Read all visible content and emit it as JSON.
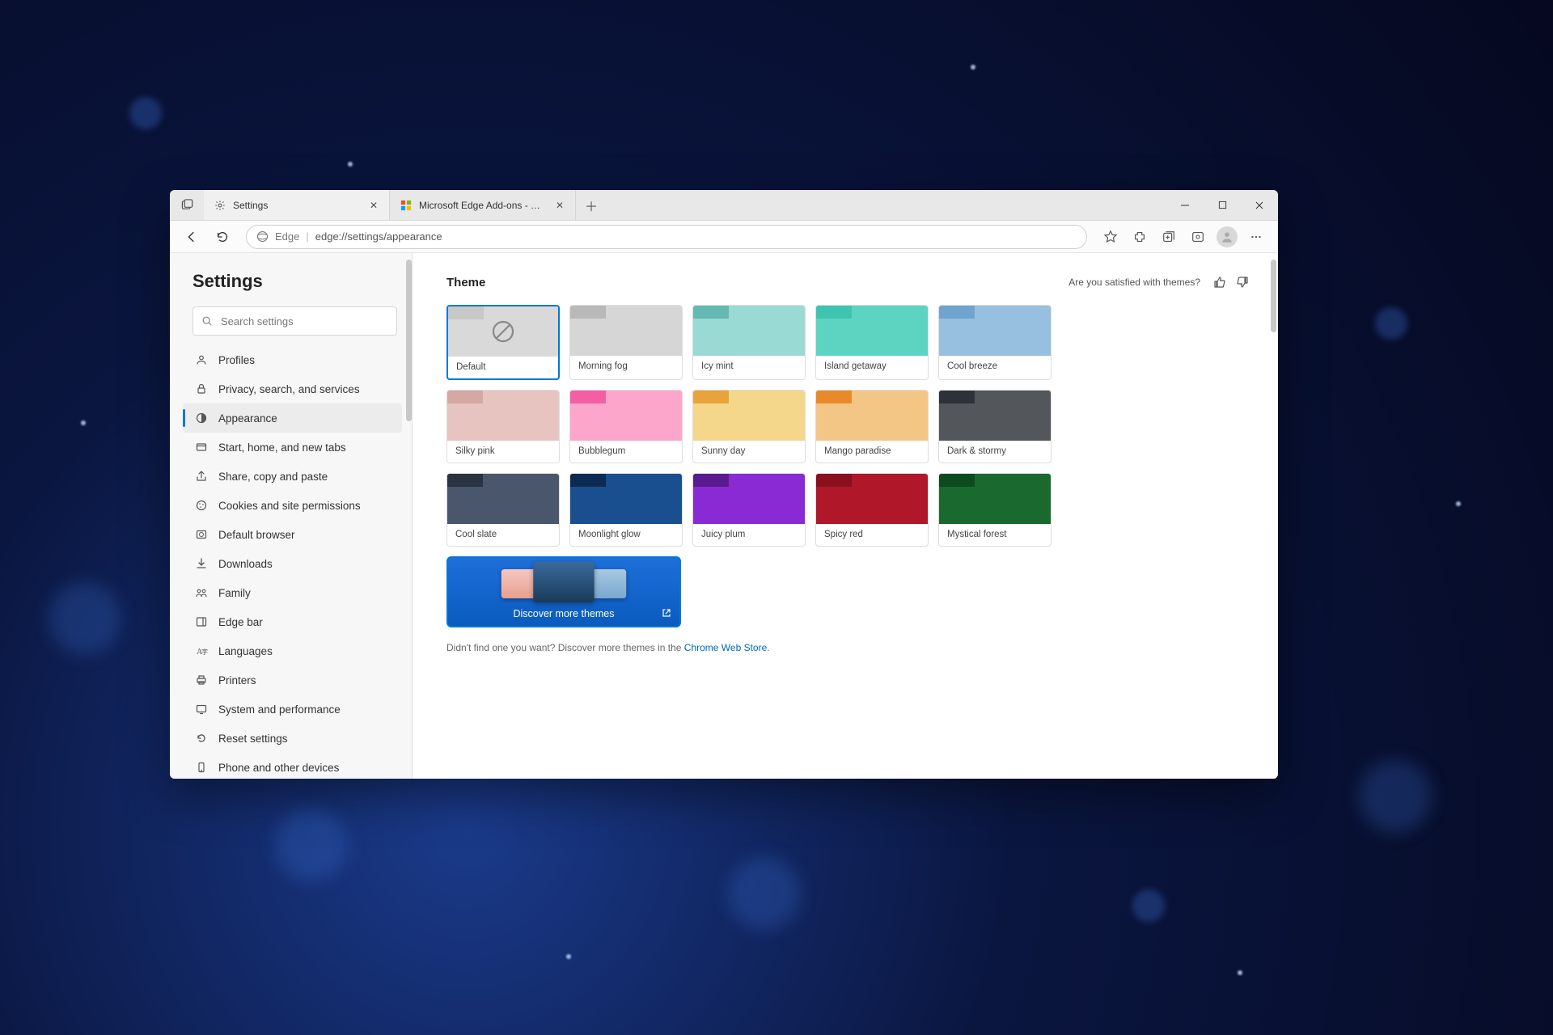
{
  "tabs": [
    {
      "label": "Settings",
      "icon": "gear"
    },
    {
      "label": "Microsoft Edge Add-ons - Theme",
      "icon": "edge-logo"
    }
  ],
  "address": {
    "scheme_label": "Edge",
    "url": "edge://settings/appearance"
  },
  "sidebar": {
    "title": "Settings",
    "search_placeholder": "Search settings",
    "items": [
      {
        "label": "Profiles",
        "icon": "person"
      },
      {
        "label": "Privacy, search, and services",
        "icon": "lock"
      },
      {
        "label": "Appearance",
        "icon": "appearance",
        "active": true
      },
      {
        "label": "Start, home, and new tabs",
        "icon": "tab"
      },
      {
        "label": "Share, copy and paste",
        "icon": "share"
      },
      {
        "label": "Cookies and site permissions",
        "icon": "cookie"
      },
      {
        "label": "Default browser",
        "icon": "browser"
      },
      {
        "label": "Downloads",
        "icon": "download"
      },
      {
        "label": "Family",
        "icon": "family"
      },
      {
        "label": "Edge bar",
        "icon": "edgebar"
      },
      {
        "label": "Languages",
        "icon": "language"
      },
      {
        "label": "Printers",
        "icon": "printer"
      },
      {
        "label": "System and performance",
        "icon": "system"
      },
      {
        "label": "Reset settings",
        "icon": "reset"
      },
      {
        "label": "Phone and other devices",
        "icon": "phone"
      }
    ]
  },
  "theme_section": {
    "heading": "Theme",
    "satisfied_text": "Are you satisfied with themes?",
    "themes": [
      {
        "name": "Default",
        "tab": "#c8c8c8",
        "body": "#d9d9d9",
        "selected": true,
        "default": true
      },
      {
        "name": "Morning fog",
        "tab": "#b9b9b9",
        "body": "#d6d6d6"
      },
      {
        "name": "Icy mint",
        "tab": "#64b9b3",
        "body": "#9adad4"
      },
      {
        "name": "Island getaway",
        "tab": "#3fc4b0",
        "body": "#5dd4c2"
      },
      {
        "name": "Cool breeze",
        "tab": "#6fa4cf",
        "body": "#97bfe0"
      },
      {
        "name": "Silky pink",
        "tab": "#d6a8a3",
        "body": "#e7c4bf"
      },
      {
        "name": "Bubblegum",
        "tab": "#f45fa4",
        "body": "#fca6cb"
      },
      {
        "name": "Sunny day",
        "tab": "#e8a43a",
        "body": "#f4d78a"
      },
      {
        "name": "Mango paradise",
        "tab": "#e88a2a",
        "body": "#f4c686"
      },
      {
        "name": "Dark & stormy",
        "tab": "#2e3238",
        "body": "#53575c"
      },
      {
        "name": "Cool slate",
        "tab": "#2a3342",
        "body": "#4a566b"
      },
      {
        "name": "Moonlight glow",
        "tab": "#0c2b52",
        "body": "#1a4f8f"
      },
      {
        "name": "Juicy plum",
        "tab": "#5a1b90",
        "body": "#8a2ad4"
      },
      {
        "name": "Spicy red",
        "tab": "#8a1020",
        "body": "#b0182a"
      },
      {
        "name": "Mystical forest",
        "tab": "#0d4a20",
        "body": "#1a6a30"
      }
    ],
    "discover_label": "Discover more themes",
    "footnote_prefix": "Didn't find one you want? Discover more themes in the ",
    "footnote_link": "Chrome Web Store",
    "footnote_suffix": "."
  }
}
